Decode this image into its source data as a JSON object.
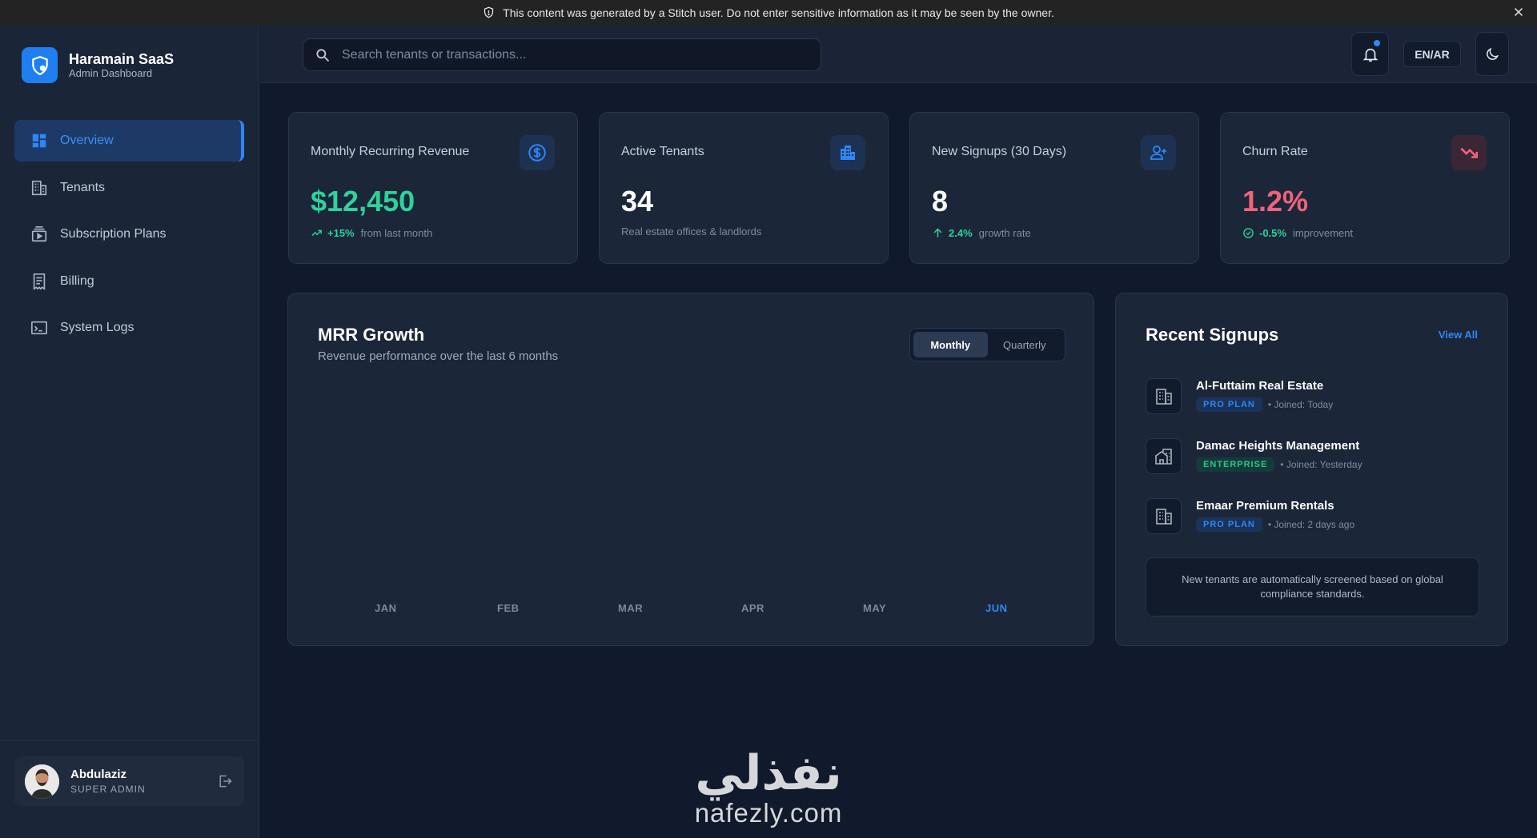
{
  "banner": {
    "text": "This content was generated by a Stitch user. Do not enter sensitive information as it may be seen by the owner."
  },
  "brand": {
    "title": "Haramain SaaS",
    "subtitle": "Admin Dashboard"
  },
  "nav": {
    "items": [
      {
        "label": "Overview",
        "icon": "dashboard-icon",
        "active": true
      },
      {
        "label": "Tenants",
        "icon": "building-icon"
      },
      {
        "label": "Subscription Plans",
        "icon": "subscriptions-icon"
      },
      {
        "label": "Billing",
        "icon": "receipt-icon"
      },
      {
        "label": "System Logs",
        "icon": "terminal-icon"
      }
    ]
  },
  "user": {
    "name": "Abdulaziz",
    "role": "SUPER ADMIN"
  },
  "header": {
    "search_placeholder": "Search tenants or transactions...",
    "lang_label": "EN/AR"
  },
  "stats": [
    {
      "label": "Monthly Recurring Revenue",
      "value": "$12,450",
      "delta": "+15%",
      "note": "from last month",
      "icon": "dollar-icon",
      "color": "#2ed29a"
    },
    {
      "label": "Active Tenants",
      "value": "34",
      "note": "Real estate offices & landlords",
      "icon": "apartment-icon",
      "color": "#ffffff"
    },
    {
      "label": "New Signups (30 Days)",
      "value": "8",
      "delta": "2.4%",
      "note": "growth rate",
      "icon": "person-add-icon",
      "color": "#ffffff"
    },
    {
      "label": "Churn Rate",
      "value": "1.2%",
      "delta": "-0.5%",
      "note": "improvement",
      "icon": "trending-down-icon",
      "color": "#f0637a"
    }
  ],
  "chart": {
    "title": "MRR Growth",
    "subtitle": "Revenue performance over the last 6 months",
    "toggle": {
      "monthly": "Monthly",
      "quarterly": "Quarterly"
    },
    "months": [
      "JAN",
      "FEB",
      "MAR",
      "APR",
      "MAY",
      "JUN"
    ]
  },
  "signups": {
    "title": "Recent Signups",
    "view_all": "View All",
    "items": [
      {
        "name": "Al-Futtaim Real Estate",
        "plan": "PRO PLAN",
        "joined": "• Joined: Today"
      },
      {
        "name": "Damac Heights Management",
        "plan": "ENTERPRISE",
        "joined": "• Joined: Yesterday"
      },
      {
        "name": "Emaar Premium Rentals",
        "plan": "PRO PLAN",
        "joined": "• Joined: 2 days ago"
      }
    ],
    "note": "New tenants are automatically screened based on global compliance standards."
  },
  "watermark": {
    "arabic": "نفذلي",
    "latin": "nafezly.com"
  },
  "colors": {
    "accent": "#2f86f6",
    "success": "#2ed29a",
    "danger": "#f0637a",
    "background": "#111a2c",
    "card": "#1c2639"
  }
}
